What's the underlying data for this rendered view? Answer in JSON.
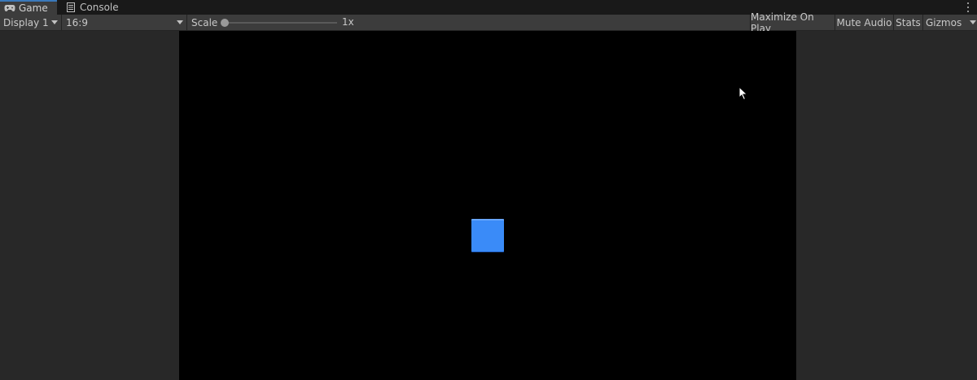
{
  "tabs": [
    {
      "label": "Game",
      "icon": "gamepad-icon",
      "active": true
    },
    {
      "label": "Console",
      "icon": "console-icon",
      "active": false
    }
  ],
  "toolbar": {
    "display_label": "Display 1",
    "aspect_label": "16:9",
    "scale_label": "Scale",
    "scale_value": "1x",
    "scale_level": 0,
    "maximize_label": "Maximize On Play",
    "mute_label": "Mute Audio",
    "stats_label": "Stats",
    "gizmos_label": "Gizmos"
  },
  "game_view": {
    "background": "#000000",
    "cube_color": "#3a8bf8"
  },
  "colors": {
    "accent": "#3a79bb",
    "panel_bg": "#282828",
    "toolbar_bg": "#3c3c3c"
  }
}
